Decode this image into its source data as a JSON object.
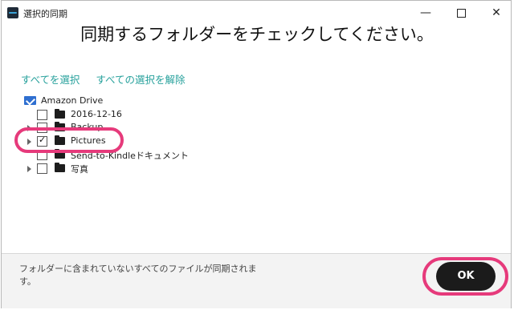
{
  "window": {
    "title": "選択的同期"
  },
  "heading": "同期するフォルダーをチェックしてください。",
  "links": {
    "select_all": "すべてを選択",
    "deselect_all": "すべての選択を解除"
  },
  "tree": {
    "root": "Amazon Drive",
    "items": [
      {
        "label": "2016-12-16",
        "checked": false,
        "expandable": false
      },
      {
        "label": "Backup",
        "checked": false,
        "expandable": true
      },
      {
        "label": "Pictures",
        "checked": true,
        "expandable": true
      },
      {
        "label": "Send-to-Kindleドキュメント",
        "checked": false,
        "expandable": false
      },
      {
        "label": "写真",
        "checked": false,
        "expandable": true
      }
    ]
  },
  "footer": {
    "note": "フォルダーに含まれていないすべてのファイルが同期されます。",
    "ok_label": "OK"
  },
  "colors": {
    "link": "#27a19c",
    "highlight": "#e63a7b",
    "button_bg": "#1b1b1b"
  }
}
